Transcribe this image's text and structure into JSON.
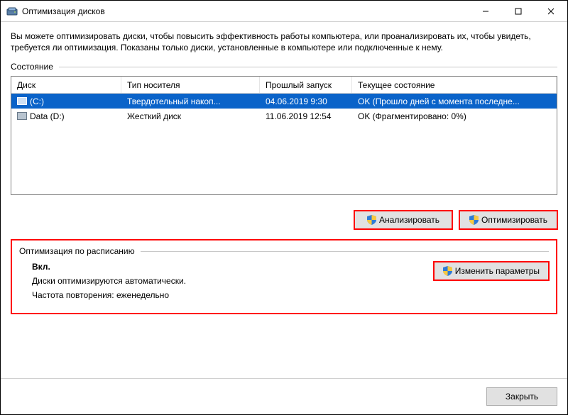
{
  "window": {
    "title": "Оптимизация дисков"
  },
  "intro": "Вы можете оптимизировать диски, чтобы повысить эффективность работы  компьютера, или проанализировать их, чтобы увидеть, требуется ли оптимизация. Показаны только диски, установленные в компьютере или подключенные к нему.",
  "state_label": "Состояние",
  "columns": {
    "disk": "Диск",
    "type": "Тип носителя",
    "last": "Прошлый запуск",
    "state": "Текущее состояние"
  },
  "rows": [
    {
      "name": "(C:)",
      "type": "Твердотельный накоп...",
      "last": "04.06.2019 9:30",
      "state": "OK (Прошло дней с момента последне...",
      "selected": true
    },
    {
      "name": "Data (D:)",
      "type": "Жесткий диск",
      "last": "11.06.2019 12:54",
      "state": "OK (Фрагментировано: 0%)",
      "selected": false
    }
  ],
  "buttons": {
    "analyze": "Анализировать",
    "optimize": "Оптимизировать",
    "change": "Изменить параметры",
    "close": "Закрыть"
  },
  "schedule": {
    "title": "Оптимизация по расписанию",
    "status": "Вкл.",
    "line1": "Диски оптимизируются автоматически.",
    "line2": "Частота повторения: еженедельно"
  }
}
